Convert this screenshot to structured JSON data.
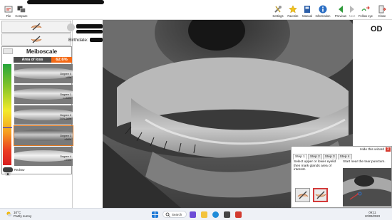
{
  "toolbar": {
    "file_label": "File",
    "compare_label": "Compare",
    "settings_label": "Settings",
    "favorite_label": "Favorite",
    "manual_label": "Manual",
    "information_label": "Information",
    "previous_label": "Previous",
    "next_label": "Next",
    "fellow_eye_label": "Fellow eye",
    "close_label": "Close"
  },
  "patient": {
    "birthdate_label": "Birthdate:"
  },
  "eye_side": "OD",
  "meiboscale": {
    "title": "Meiboscale",
    "area_of_loss_label": "Area of loss",
    "area_of_loss_value": "62.6%",
    "degrees": [
      {
        "name": "Degree 0",
        "range": "<0%"
      },
      {
        "name": "Degree 1",
        "range": "<=33%"
      },
      {
        "name": "Degree 2",
        "range": "34%-66%"
      },
      {
        "name": "Degree 3",
        "range": ">66%"
      },
      {
        "name": "Degree 4",
        "range": ">75%"
      }
    ],
    "selected_degree": 3,
    "redraw_label": "Redraw",
    "scale_colors": [
      "#27a43b",
      "#84c429",
      "#f3ea2c",
      "#f59b21",
      "#ea3a22",
      "#d71f20"
    ]
  },
  "wizard": {
    "hide_label": "Hide this wizard",
    "close_glyph": "X",
    "tabs": [
      "Step 1",
      "Step 2",
      "Step 3",
      "Step 4"
    ],
    "active_tab": 0,
    "instruction_left": "Select upper or lower eyelid then mark glands area of interest.",
    "instruction_right": "Start near the tear punctum."
  },
  "taskbar": {
    "weather_temp": "10°C",
    "weather_desc": "Partly sunny",
    "search_label": "Search",
    "time": "09:11",
    "date": "20/03/2023"
  },
  "colors": {
    "accent_orange": "#f46a16",
    "wizard_select_red": "#d43a3a"
  }
}
